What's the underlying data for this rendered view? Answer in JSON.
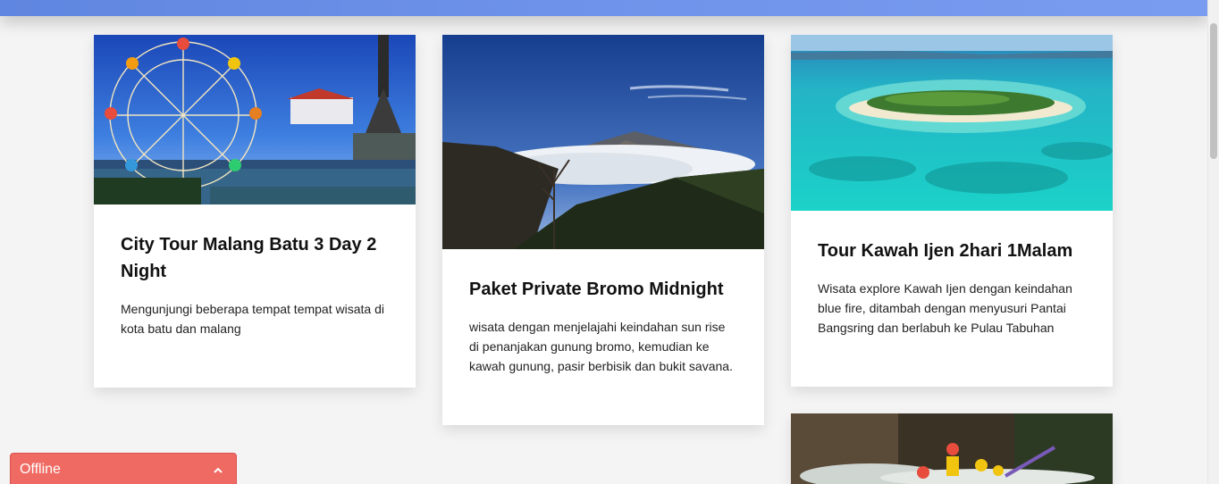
{
  "cards": [
    {
      "title": "City Tour Malang Batu 3 Day 2 Night",
      "description": "Mengunjungi beberapa tempat tempat wisata di kota batu dan malang",
      "image": "ferris-wheel-city-monument"
    },
    {
      "title": "Paket Private Bromo Midnight",
      "description": "wisata dengan menjelajahi keindahan sun rise di penanjakan gunung bromo, kemudian ke kawah gunung, pasir berbisik dan bukit savana.",
      "image": "bromo-mountain-sea-of-clouds"
    },
    {
      "title": "Tour Kawah Ijen 2hari 1Malam",
      "description": "Wisata explore Kawah Ijen dengan keindahan blue fire, ditambah dengan menyusuri Pantai Bangsring dan berlabuh ke Pulau Tabuhan",
      "image": "tropical-island-turquoise-sea"
    },
    {
      "image": "river-rafting"
    }
  ],
  "chat_widget": {
    "status_label": "Offline",
    "icon": "chevron-up-icon"
  },
  "colors": {
    "header": "#6f93ea",
    "chat_widget": "#ef6a62",
    "page_background": "#f4f4f4"
  }
}
